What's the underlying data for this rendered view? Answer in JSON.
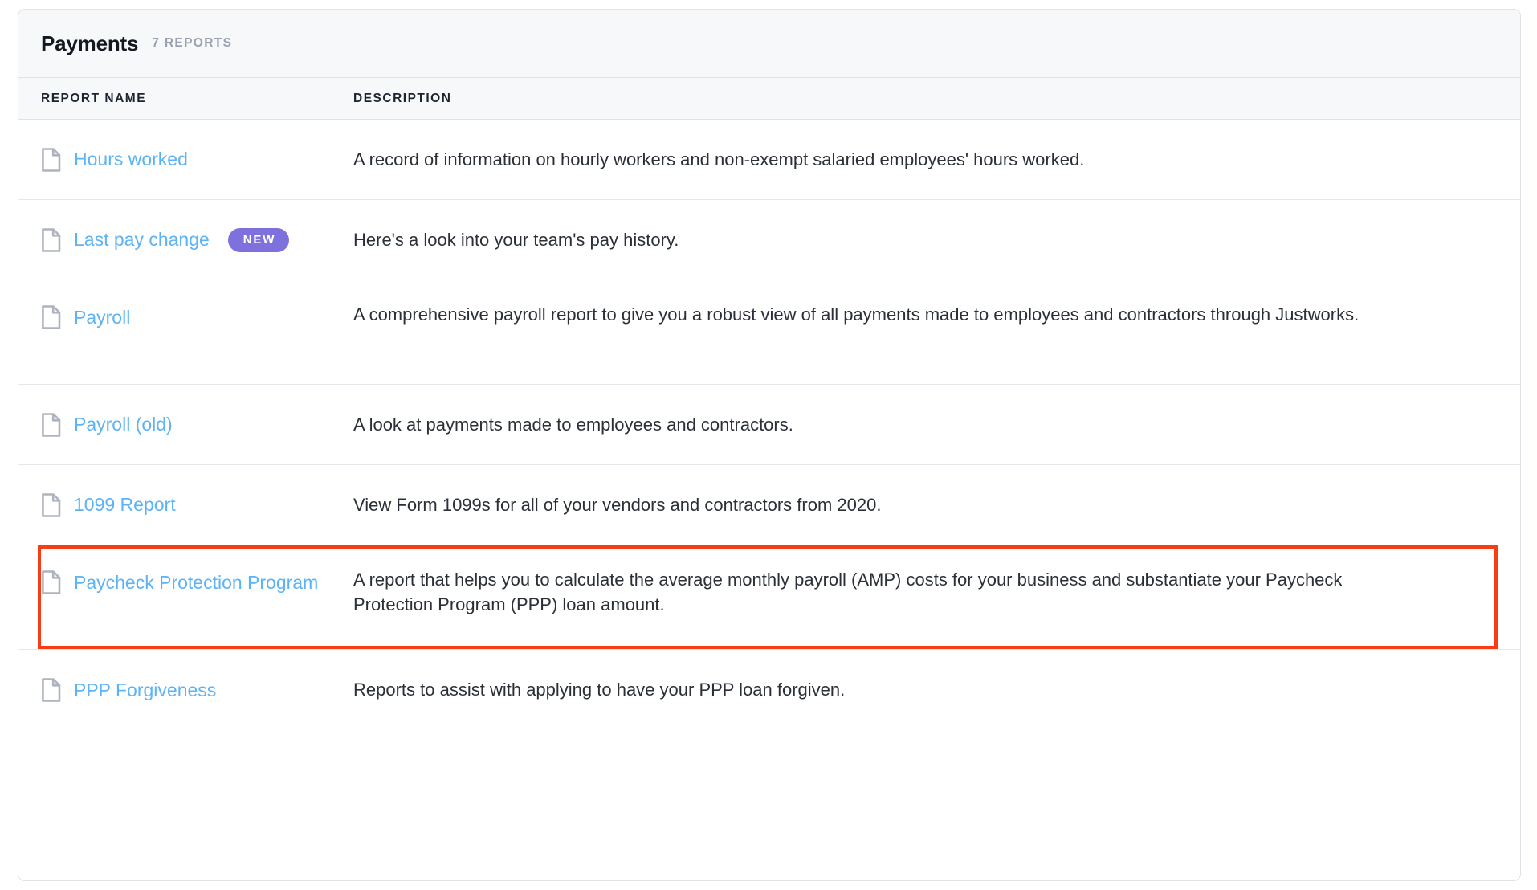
{
  "card": {
    "title": "Payments",
    "count_label": "7 REPORTS"
  },
  "columns": {
    "name": "REPORT NAME",
    "description": "DESCRIPTION"
  },
  "colors": {
    "link": "#5cb3f5",
    "badge_new": "#7e71dd",
    "highlight_border": "#fa3c14",
    "header_background": "#f6f8fa",
    "card_border": "#dfe3e8",
    "icon": "#aeb4bd",
    "text": "#2b3038"
  },
  "reports": [
    {
      "name": "Hours worked",
      "description": "A record of information on hourly workers and non-exempt salaried employees' hours worked.",
      "badge": null,
      "highlighted": false,
      "lines": 1
    },
    {
      "name": "Last pay change",
      "description": "Here's a look into your team's pay history.",
      "badge": "NEW",
      "highlighted": false,
      "lines": 1
    },
    {
      "name": "Payroll",
      "description": "A comprehensive payroll report to give you a robust view of all payments made to employees and contractors through Justworks.",
      "badge": null,
      "highlighted": false,
      "lines": 2
    },
    {
      "name": "Payroll (old)",
      "description": "A look at payments made to employees and contractors.",
      "badge": null,
      "highlighted": false,
      "lines": 1
    },
    {
      "name": "1099 Report",
      "description": "View Form 1099s for all of your vendors and contractors from 2020.",
      "badge": null,
      "highlighted": false,
      "lines": 1
    },
    {
      "name": "Paycheck Protection Program",
      "description": "A report that helps you to calculate the average monthly payroll (AMP) costs for your business and substantiate your Paycheck Protection Program (PPP) loan amount.",
      "badge": null,
      "highlighted": true,
      "lines": 2
    },
    {
      "name": "PPP Forgiveness",
      "description": "Reports to assist with applying to have your PPP loan forgiven.",
      "badge": null,
      "highlighted": false,
      "lines": 1
    }
  ]
}
